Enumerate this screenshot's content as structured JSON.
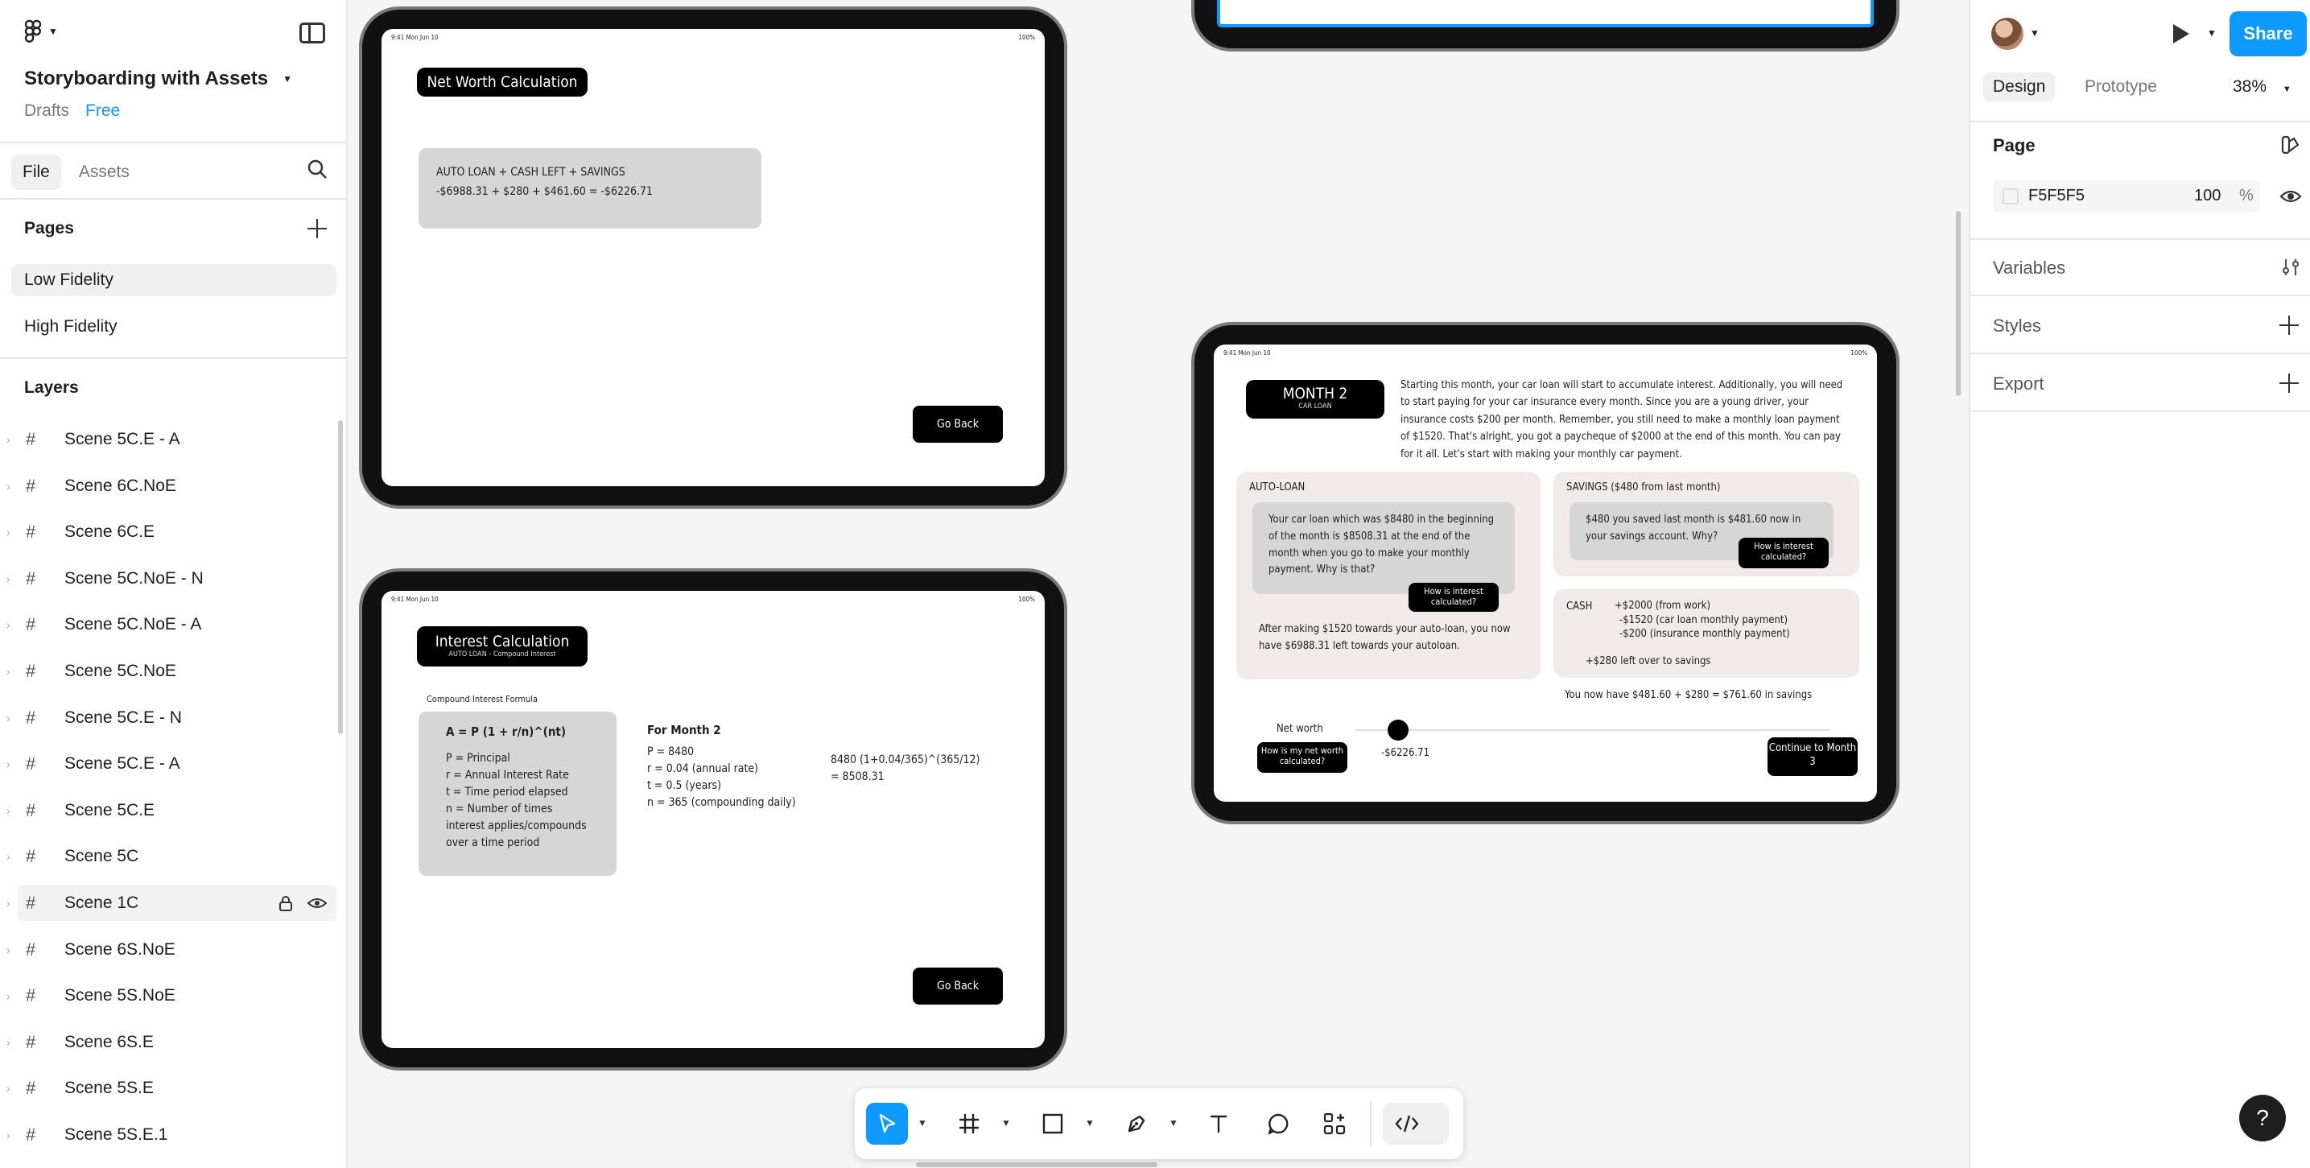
{
  "left_panel": {
    "file_title": "Storyboarding with Assets",
    "location": "Drafts",
    "plan": "Free",
    "tabs": [
      "File",
      "Assets"
    ],
    "pages_heading": "Pages",
    "pages": [
      "Low Fidelity",
      "High Fidelity"
    ],
    "layers_heading": "Layers",
    "layers": [
      "Scene 5C.E - A",
      "Scene 6C.NoE",
      "Scene 6C.E",
      "Scene 5C.NoE - N",
      "Scene 5C.NoE - A",
      "Scene 5C.NoE",
      "Scene 5C.E - N",
      "Scene 5C.E - A",
      "Scene 5C.E",
      "Scene 5C",
      "Scene 1C",
      "Scene 6S.NoE",
      "Scene 5S.NoE",
      "Scene 6S.E",
      "Scene 5S.E",
      "Scene 5S.E.1"
    ]
  },
  "right_panel": {
    "share_label": "Share",
    "tabs": [
      "Design",
      "Prototype"
    ],
    "zoom": "38%",
    "page_heading": "Page",
    "bg_color": "F5F5F5",
    "bg_opacity": "100",
    "bg_opacity_unit": "%",
    "sections": [
      "Variables",
      "Styles",
      "Export"
    ],
    "help": "?"
  },
  "canvas": {
    "frame1": {
      "status_time": "9:41  Mon Jun 10",
      "status_batt": "100%",
      "title": "Net Worth Calculation",
      "formula_line1": "AUTO LOAN + CASH LEFT + SAVINGS",
      "formula_line2": "-$6988.31 + $280 + $461.60 = -$6226.71",
      "button": "Go Back"
    },
    "frame2": {
      "status_time": "9:41  Mon Jun 10",
      "status_batt": "100%",
      "title": "Interest Calculation",
      "subtitle": "AUTO LOAN - Compound Interest",
      "formula_label": "Compound Interest Formula",
      "formula": "A = P (1 + r/n)^(nt)",
      "defs": [
        "P = Principal",
        "r = Annual Interest Rate",
        "t = Time period elapsed",
        "n = Number of times interest applies/compounds over a time period"
      ],
      "month_heading": "For Month 2",
      "month_vals": [
        "P = 8480",
        "r = 0.04 (annual rate)",
        "t = 0.5 (years)",
        "n = 365 (compounding daily)"
      ],
      "calc_line1": "8480 (1+0.04/365)^(365/12)",
      "calc_line2": "= 8508.31",
      "button": "Go Back"
    },
    "frame3": {
      "status_time": "9:41  Mon Jun 10",
      "status_batt": "100%",
      "title": "MONTH 2",
      "subtitle": "CAR LOAN",
      "intro": "Starting this month, your car loan will start to accumulate interest. Additionally, you will need to start paying for your car insurance every month. Since you are a young driver, your insurance costs $200 per month. Remember, you still need to make a monthly loan payment of $1520. That's alright, you got a paycheque of $2000 at the end of this month. You can pay for it all. Let's start with making your monthly car payment.",
      "auto_heading": "AUTO-LOAN",
      "auto_text": "Your car loan which was $8480 in the beginning of the month is $8508.31 at the end of the month when you go to make your monthly payment. Why is that?",
      "auto_btn": "How is interest calculated?",
      "auto_after": "After making $1520 towards your auto-loan, you now have $6988.31 left towards your autoloan.",
      "savings_heading": "SAVINGS ($480 from last month)",
      "savings_text": "$480 you saved last month is $481.60 now in your savings account. Why?",
      "savings_btn": "How is interest calculated?",
      "cash_heading": "CASH",
      "cash_lines": [
        "+$2000 (from work)",
        "-$1520 (car loan monthly payment)",
        "-$200 (insurance monthly payment)"
      ],
      "cash_left": "+$280 left over to savings",
      "savings_total": "You now have $481.60 + $280 =  $761.60  in savings",
      "networth_label": "Net worth",
      "networth_btn": "How is my net worth calculated?",
      "networth_value": "-$6226.71",
      "continue_btn": "Continue to Month 3"
    }
  },
  "toolbar": {
    "tools": [
      "move-tool",
      "frame-tool",
      "shape-tool",
      "pen-tool",
      "text-tool",
      "comment-tool",
      "actions-tool",
      "dev-mode-toggle"
    ]
  },
  "colors": {
    "accent": "#0d99ff",
    "canvas_bg": "#F5F5F5",
    "panel_bg": "#ffffff"
  }
}
